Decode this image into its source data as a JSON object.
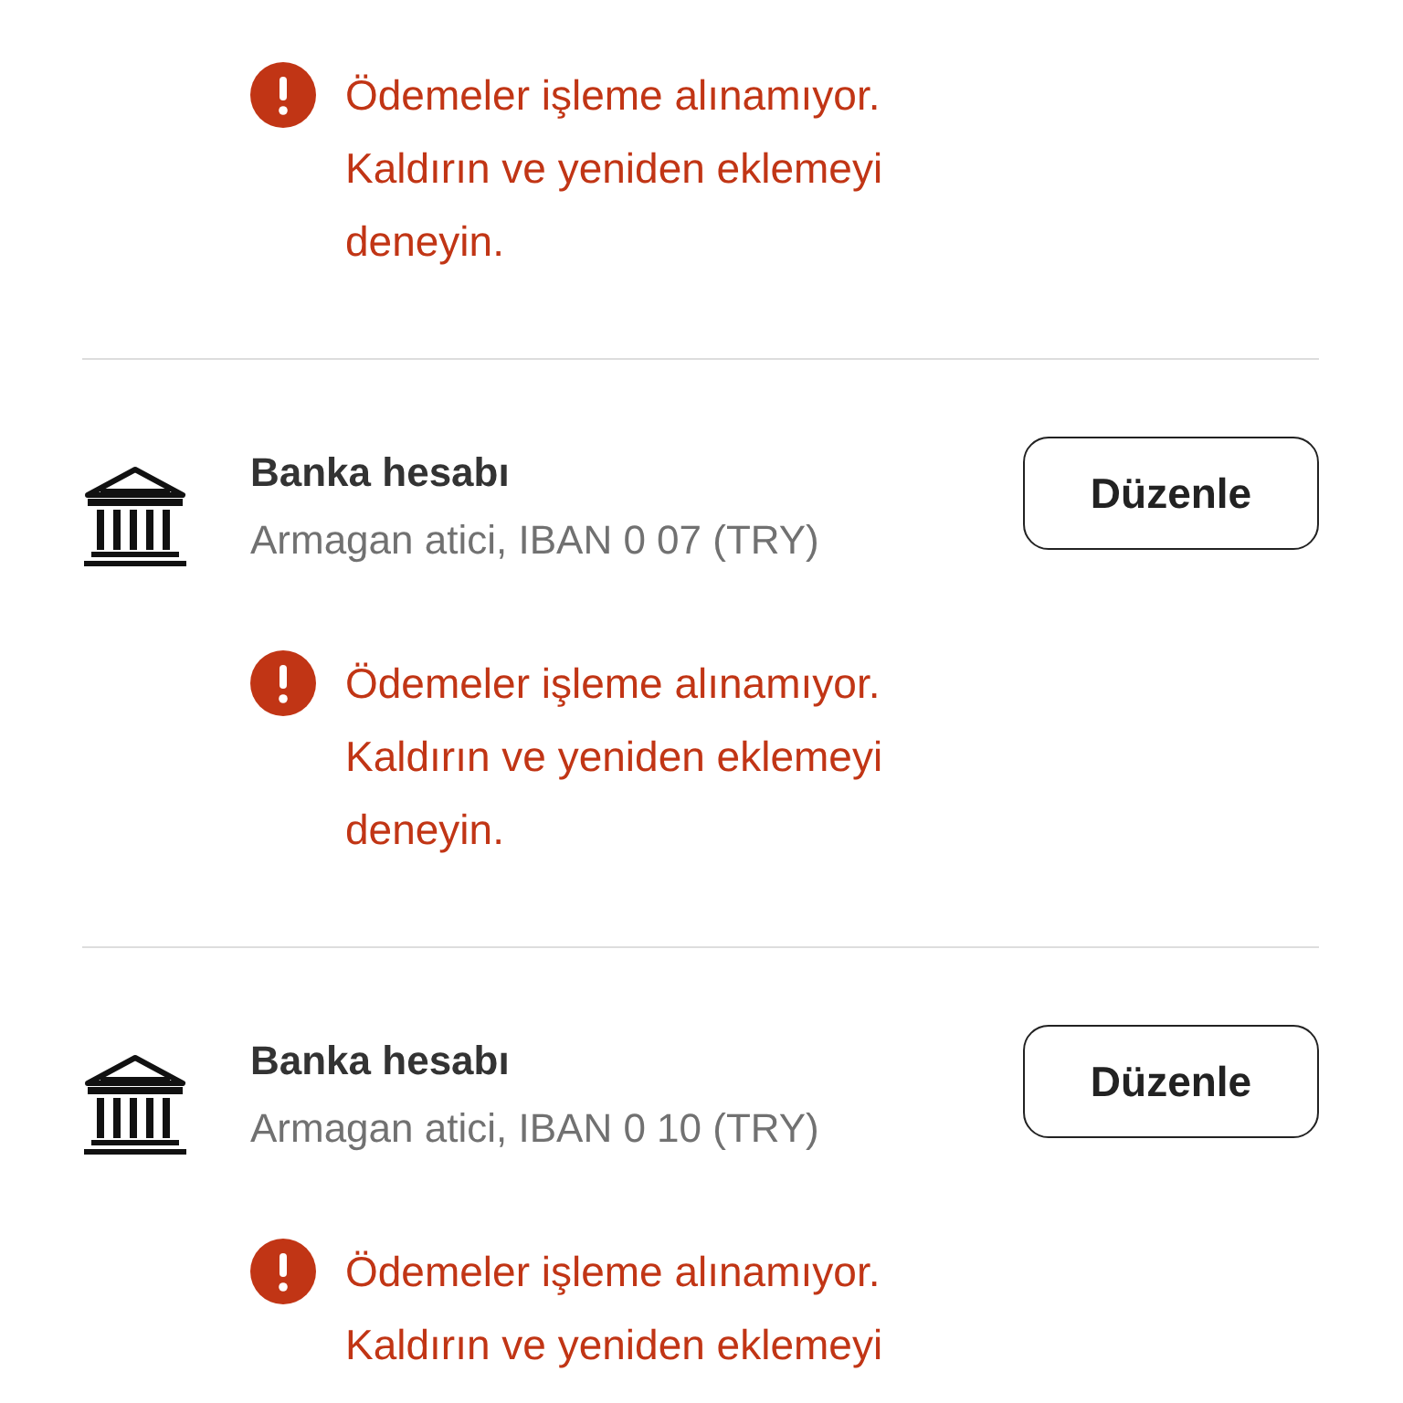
{
  "sections": [
    {
      "kind": "error-only",
      "error": "Ödemeler işleme alınamıyor. Kaldırın ve yeniden eklemeyi deneyin."
    },
    {
      "kind": "account",
      "title": "Banka hesabı",
      "subtitle": "Armagan atici, IBAN 0 07 (TRY)",
      "button": "Düzenle",
      "error": "Ödemeler işleme alınamıyor. Kaldırın ve yeniden eklemeyi deneyin."
    },
    {
      "kind": "account",
      "title": "Banka hesabı",
      "subtitle": "Armagan atici, IBAN 0 10 (TRY)",
      "button": "Düzenle",
      "error": "Ödemeler işleme alınamıyor. Kaldırın ve yeniden eklemeyi"
    }
  ]
}
